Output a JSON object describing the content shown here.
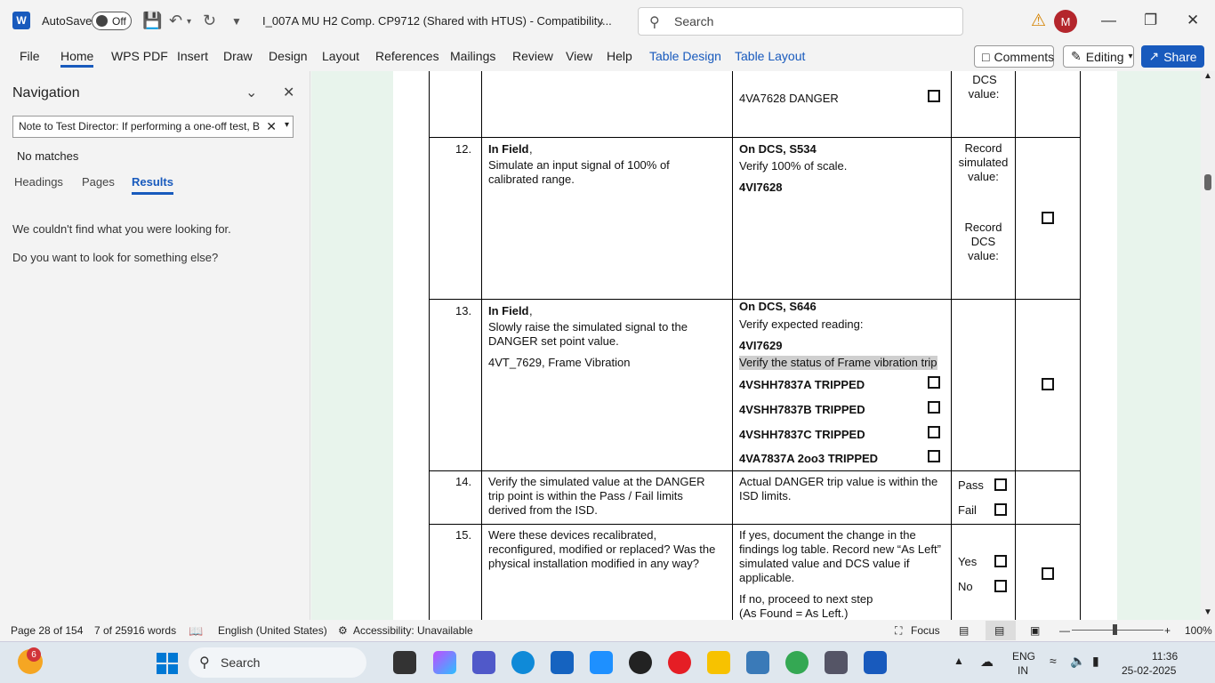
{
  "titlebar": {
    "autosave_label": "AutoSave",
    "autosave_state": "Off",
    "doc_title": "I_007A MU H2 Comp. CP9712 (Shared with HTUS)  -  Compatibility...",
    "search_placeholder": "Search",
    "avatar_initial": "M"
  },
  "ribbon": {
    "tabs": [
      "File",
      "Home",
      "WPS PDF",
      "Insert",
      "Draw",
      "Design",
      "Layout",
      "References",
      "Mailings",
      "Review",
      "View",
      "Help",
      "Table Design",
      "Table Layout"
    ],
    "comments": "Comments",
    "editing": "Editing",
    "share": "Share"
  },
  "nav": {
    "title": "Navigation",
    "search_value": "Note to Test Director: If performing a one-off test, B",
    "no_matches": "No matches",
    "tabs": [
      "Headings",
      "Pages",
      "Results"
    ],
    "msg1": "We couldn't find what you were looking for.",
    "msg2": "Do you want to look for something else?"
  },
  "table": {
    "r0": {
      "c3": "4VA7628 DANGER",
      "c4a": "DCS",
      "c4b": "value:"
    },
    "r12": {
      "num": "12.",
      "c2a": "In Field",
      "c2b": ",",
      "c2c": "Simulate an input signal of 100% of calibrated range.",
      "c3a": "On DCS, S534",
      "c3b": "Verify 100% of scale.",
      "c3c": "4VI7628",
      "c4a": "Record simulated value:",
      "c4b": "Record DCS value:"
    },
    "r13": {
      "num": "13.",
      "c2a": "In Field",
      "c2b": ",",
      "c2c": "Slowly raise the simulated signal to the DANGER set point value.",
      "c2d": "4VT_7629, Frame Vibration",
      "c3a": "On DCS, S646",
      "c3b": "Verify expected reading:",
      "c3c": "4VI7629",
      "c3d": "Verify the status of Frame vibration trip",
      "c3e": "4VSHH7837A TRIPPED",
      "c3f": "4VSHH7837B TRIPPED",
      "c3g": "4VSHH7837C TRIPPED",
      "c3h": "4VA7837A 2oo3 TRIPPED"
    },
    "r14": {
      "num": "14.",
      "c2": "Verify the simulated value at the DANGER trip point is within the Pass / Fail limits derived from the ISD.",
      "c3": "Actual DANGER trip value is within the ISD limits.",
      "pass": "Pass",
      "fail": "Fail"
    },
    "r15": {
      "num": "15.",
      "c2": "Were these devices recalibrated, reconfigured, modified or replaced? Was the physical installation modified in any way?",
      "c3a": "If yes, document the change in the findings log table. Record new “As Left” simulated value and DCS value if applicable.",
      "c3b": "If no, proceed to next step",
      "c3c": "(As Found = As Left.)",
      "yes": "Yes",
      "no": "No"
    }
  },
  "status": {
    "page": "Page 28 of 154",
    "words": "7 of 25916 words",
    "language": "English (United States)",
    "accessibility": "Accessibility: Unavailable",
    "focus": "Focus",
    "zoom": "100%"
  },
  "taskbar": {
    "search": "Search",
    "badge": "6",
    "lang1": "ENG",
    "lang2": "IN",
    "time": "11:36",
    "date": "25-02-2025"
  }
}
